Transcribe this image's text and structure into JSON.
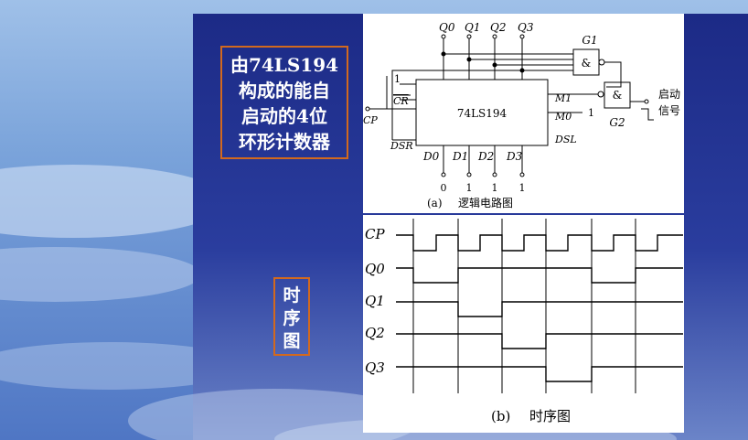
{
  "title_box": {
    "lines": [
      "由74LS194",
      "构成的能自",
      "启动的4位",
      "环形计数器"
    ]
  },
  "timing_box": {
    "lines": [
      "时",
      "序",
      "图"
    ]
  },
  "logic": {
    "chip": "74LS194",
    "outputs": [
      "Q0",
      "Q1",
      "Q2",
      "Q3"
    ],
    "gate_top": {
      "symbol": "&",
      "name": "G1"
    },
    "gate_bottom": {
      "symbol": "&",
      "name": "G2"
    },
    "pins_left": [
      "1",
      "CR",
      "CP",
      "DSR"
    ],
    "pins_right": [
      "M1",
      "M0",
      "DSL",
      "1"
    ],
    "inputs_bottom": [
      "D0",
      "D1",
      "D2",
      "D3"
    ],
    "input_values": [
      "0",
      "1",
      "1",
      "1"
    ],
    "start_signal": [
      "启动",
      "信号"
    ],
    "caption_tag": "(a)",
    "caption": "逻辑电路图"
  },
  "timing": {
    "signals": [
      "CP",
      "Q0",
      "Q1",
      "Q2",
      "Q3"
    ],
    "caption_tag": "(b)",
    "caption": "时序图"
  }
}
